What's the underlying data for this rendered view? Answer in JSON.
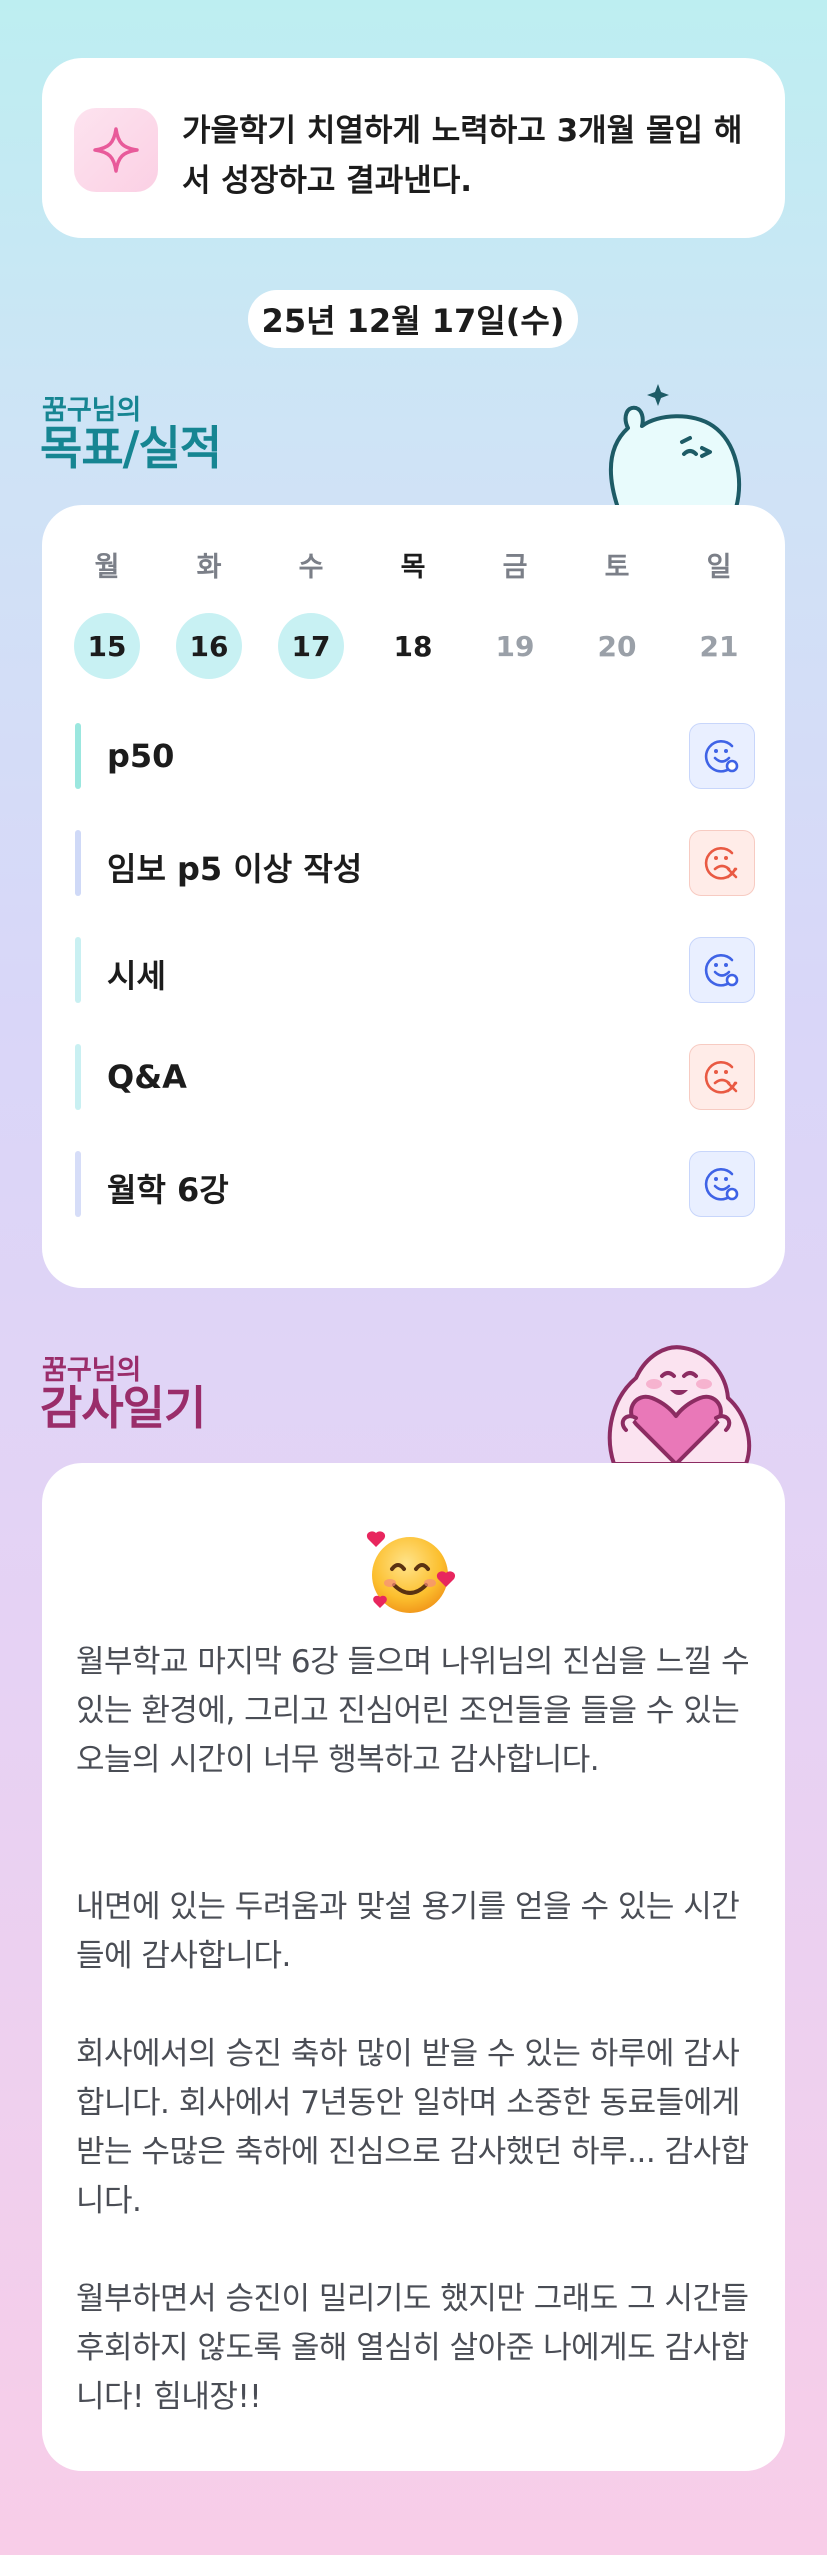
{
  "goal_banner": {
    "icon": "sparkle-icon",
    "text": "가을학기 치열하게 노력하고 3개월 몰입 해서 성장하고 결과낸다."
  },
  "date_label": "25년 12월 17일(수)",
  "goals_section": {
    "owner_label": "꿈구님의",
    "title": "목표/실적"
  },
  "week": {
    "days": [
      {
        "weekday": "월",
        "date": "15",
        "state": "done"
      },
      {
        "weekday": "화",
        "date": "16",
        "state": "done"
      },
      {
        "weekday": "수",
        "date": "17",
        "state": "done"
      },
      {
        "weekday": "목",
        "date": "18",
        "state": "today"
      },
      {
        "weekday": "금",
        "date": "19",
        "state": "future"
      },
      {
        "weekday": "토",
        "date": "20",
        "state": "future"
      },
      {
        "weekday": "일",
        "date": "21",
        "state": "future"
      }
    ]
  },
  "goals": [
    {
      "label": "p50",
      "status": "success",
      "icon": "smile-check-icon",
      "bar_color": "#9be7df"
    },
    {
      "label": "임보 p5 이상 작성",
      "status": "fail",
      "icon": "sad-x-icon",
      "bar_color": "#cfd9f7"
    },
    {
      "label": "시세",
      "status": "success",
      "icon": "smile-check-icon",
      "bar_color": "#c9f0f2"
    },
    {
      "label": "Q&A",
      "status": "fail",
      "icon": "sad-x-icon",
      "bar_color": "#c9f0f2"
    },
    {
      "label": "월학 6강",
      "status": "success",
      "icon": "smile-check-icon",
      "bar_color": "#d6ddf8"
    }
  ],
  "gratitude_section": {
    "owner_label": "꿈구님의",
    "title": "감사일기",
    "emoji": "smiling-face-with-hearts-icon",
    "paragraphs": [
      "월부학교 마지막 6강 들으며 나위님의 진심을 느낄 수 있는 환경에, 그리고 진심어린 조언들을 들을 수 있는 오늘의 시간이 너무 행복하고 감사합니다.",
      "내면에 있는 두려움과 맞설 용기를 얻을 수 있는 시간들에 감사합니다.",
      "회사에서의 승진 축하 많이 받을 수 있는 하루에 감사합니다. 회사에서 7년동안 일하며 소중한 동료들에게 받는 수많은 축하에 진심으로 감사했던 하루... 감사합니다.",
      "월부하면서 승진이 밀리기도 했지만 그래도 그 시간들 후회하지 않도록 올해 열심히 살아준 나에게도 감사합니다! 힘내장!!"
    ]
  },
  "colors": {
    "teal_title": "#168592",
    "plum_title": "#9a2d6a",
    "success_icon": "#3f63e6",
    "fail_icon": "#e95a43",
    "done_day_bg": "#c8f1f3"
  }
}
